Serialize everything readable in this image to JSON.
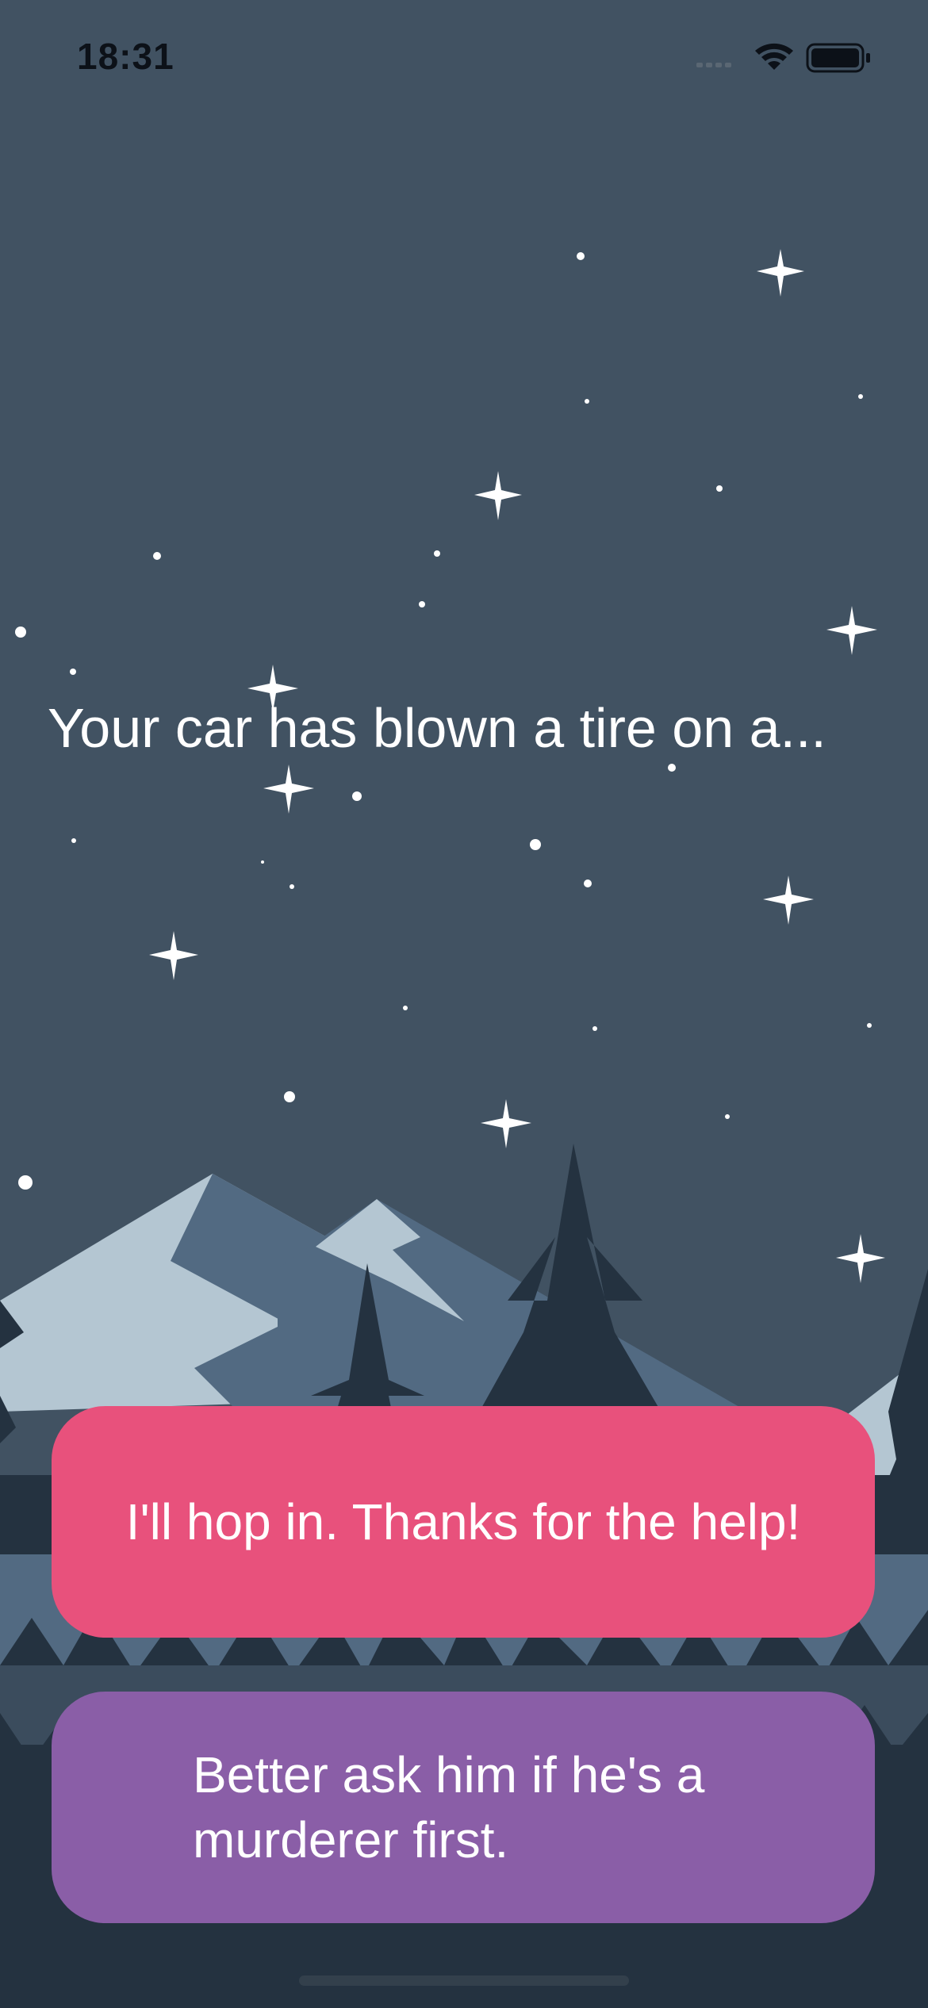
{
  "status_bar": {
    "time": "18:31",
    "icons": [
      "cellular-signal-icon",
      "wifi-icon",
      "battery-icon"
    ]
  },
  "story": {
    "text": "Your car has blown a tire on a..."
  },
  "choices": [
    {
      "label": "I'll hop in. Thanks for the help!",
      "color": "#e8517c"
    },
    {
      "label": "Better ask him if he's a murderer first.",
      "color": "#8a5ea7"
    }
  ],
  "colors": {
    "sky": "#415262",
    "mountain_light": "#b4c6d2",
    "mountain_mid": "#526a82",
    "trees_dark": "#243240"
  }
}
